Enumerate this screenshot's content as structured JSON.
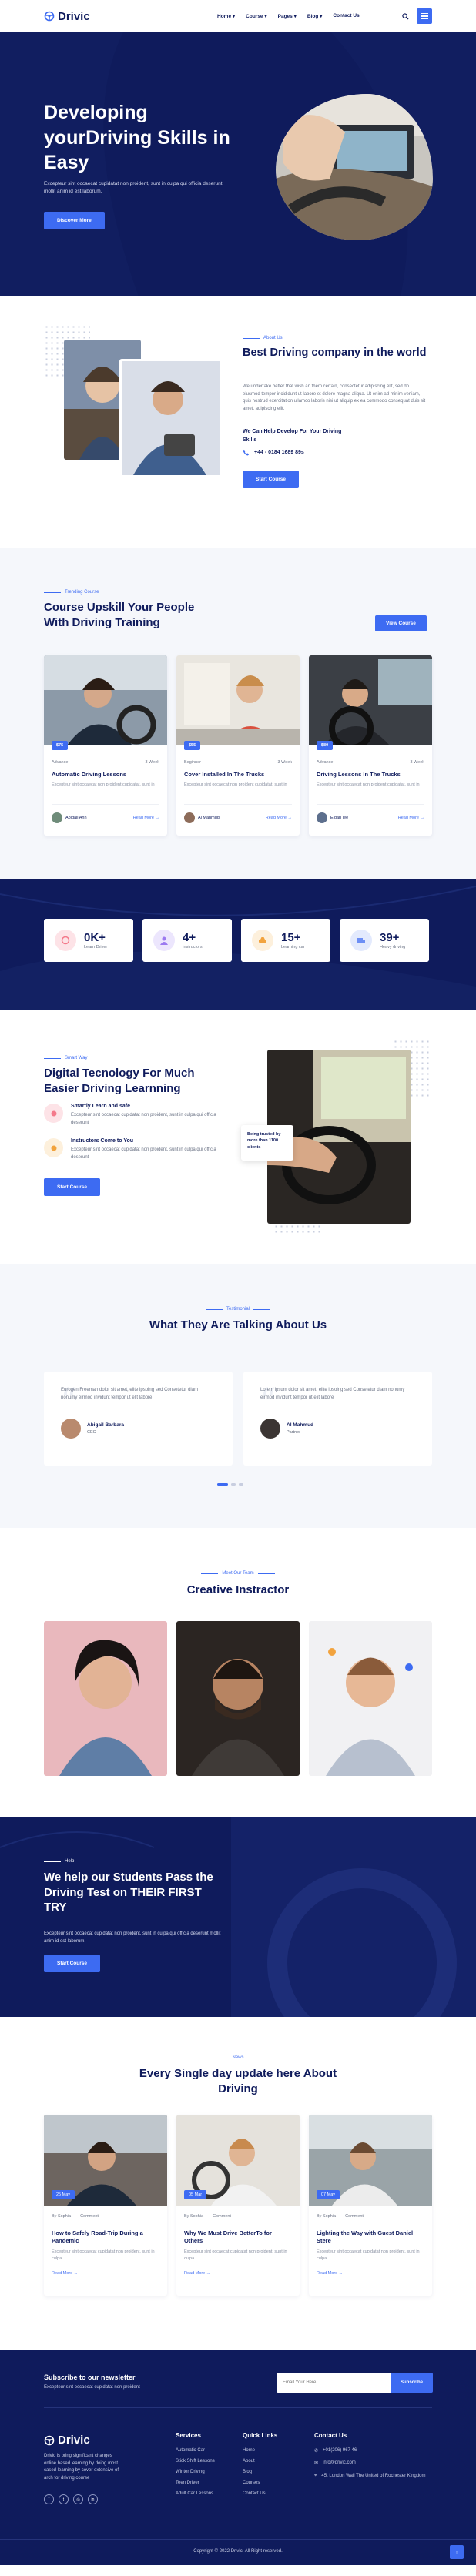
{
  "brand": {
    "name": "Drivic"
  },
  "nav": {
    "items": [
      "Home ▾",
      "Course ▾",
      "Pages ▾",
      "Blog ▾",
      "Contact Us"
    ]
  },
  "hero": {
    "title": "Developing yourDriving Skills in Easy",
    "subtitle": "Excepteur sint occaecat cupidatat non proident, sunt in culpa qui officia deserunt mollit anim id est laborum.",
    "button": "Discover More"
  },
  "about": {
    "kicker": "About Us",
    "title": "Best Driving company in the world",
    "text": "We undertake better that wish an them certain, consectetur adipiscing elit, sed do eiusmod tempor incididunt ut labore et dolore magna aliqua. Ut enim ad minim veniam, quis nostrud exercitation ullamco laboris nisi ut aliquip ex ea commodo consequat duis sit amet, adipiscing elit.",
    "help_title": "We Can Help Develop For Your Driving Skills",
    "phone": "+44 - 0184 1689 89s",
    "button": "Start Course"
  },
  "courses": {
    "kicker": "Trending Course",
    "title": "Course Upskill Your People With Driving Training",
    "button": "View Course",
    "items": [
      {
        "price": "$75",
        "level": "Advance",
        "duration": "3 Week",
        "title": "Automatic Driving Lessons",
        "desc": "Excepteur sint occaecat non proident cupidatat, sunt in",
        "author": "Abigail Ann",
        "more": "Read More →"
      },
      {
        "price": "$55",
        "level": "Beginner",
        "duration": "3 Week",
        "title": "Cover Installed In The Trucks",
        "desc": "Excepteur sint occaecat non proident cupidatat, sunt in",
        "author": "Al Mahmud",
        "more": "Read More →"
      },
      {
        "price": "$80",
        "level": "Advance",
        "duration": "3 Week",
        "title": "Driving Lessons In The Trucks",
        "desc": "Excepteur sint occaecat non proident cupidatat, sunt in",
        "author": "Elgari Iee",
        "more": "Read More →"
      }
    ]
  },
  "stats": {
    "items": [
      {
        "value": "0K+",
        "label": "Learn Driver",
        "color": "#f47a8b",
        "bg": "#fde3e7"
      },
      {
        "value": "4+",
        "label": "Instructors",
        "color": "#9b7af0",
        "bg": "#ece6fd"
      },
      {
        "value": "15+",
        "label": "Learning car",
        "color": "#f2a33d",
        "bg": "#fdf0dc"
      },
      {
        "value": "39+",
        "label": "Heavy driving",
        "color": "#6d8ff5",
        "bg": "#e3eafd"
      }
    ]
  },
  "digital": {
    "kicker": "Smart Way",
    "title": "Digital Tecnology For Much Easier Driving Learnning",
    "features": [
      {
        "title": "Smartly Learn and safe",
        "text": "Excepteur sint occaecat cupidatat non proident, sunt in culpa qui officia deserunt"
      },
      {
        "title": "Instructors Come to You",
        "text": "Excepteur sint occaecat cupidatat non proident, sunt in culpa qui officia deserunt"
      }
    ],
    "button": "Start Course",
    "badge": "Being trusted by more than 1100 clients"
  },
  "testimonials": {
    "kicker": "Testimonial",
    "title": "What They Are Talking About Us",
    "items": [
      {
        "quote": "Eurogen Freeman dolor sit amet, elite ipsoing sed Consetetur diam nonumy eirmod invidunt tempor ut elit labore",
        "name": "Abigail Barbara",
        "role": "CEO"
      },
      {
        "quote": "Lorem ipsum dolor sit amet, elite ipsoing sed Consetetur diam nonumy eirmod invidunt tempor ut elit labore",
        "name": "Al Mahmud",
        "role": "Partner"
      }
    ]
  },
  "team": {
    "kicker": "Meet Our Team",
    "title": "Creative Instractor"
  },
  "help": {
    "kicker": "Help",
    "title": "We help our Students Pass the Driving Test on THEIR FIRST TRY",
    "subtitle": "Excepteur sint occaecat cupidatat non proident, sunt in culpa qui officia deserunt mollit anim id est laborum.",
    "button": "Start Course"
  },
  "news": {
    "kicker": "News",
    "title": "Every Single day update here About Driving",
    "items": [
      {
        "date": "25 May",
        "author": "By Sophia",
        "comment": "Comment",
        "title": "How to Safely Road-Trip During a Pandemic",
        "desc": "Excepteur sint occaecat cupidatat non proident, sunt in culpa",
        "more": "Read More →"
      },
      {
        "date": "05 Mar",
        "author": "By Sophia",
        "comment": "Comment",
        "title": "Why We Must Drive BetterTo for Others",
        "desc": "Excepteur sint occaecat cupidatat non proident, sunt in culpa",
        "more": "Read More →"
      },
      {
        "date": "07 May",
        "author": "By Sophia",
        "comment": "Comment",
        "title": "Lighting the Way with Guest Daniel Stere",
        "desc": "Excepteur sint occaecat cupidatat non proident, sunt in culpa",
        "more": "Read More →"
      }
    ]
  },
  "newsletter": {
    "title": "Subscribe to our newsletter",
    "subtitle": "Excepteur sint occaecat cupidatat non proident",
    "placeholder": "Email Your Here",
    "button": "Subscribe"
  },
  "footer": {
    "about": "Drivic is bring significant changes online based learning by doing most cased learning by cover extensive of arch for driving course",
    "services_title": "Services",
    "services": [
      "Automatic Car",
      "Stick Shift Lessons",
      "Winter Driving",
      "Teen Driver",
      "Adult Car Lessons"
    ],
    "links_title": "Quick Links",
    "links": [
      "Home",
      "About",
      "Blog",
      "Courses",
      "Contact Us"
    ],
    "contact_title": "Contact Us",
    "phone": "+01(206) 967 46",
    "email": "info@drivic.com",
    "address": "45, London Wall The United of Rochester Kingdom",
    "copyright": "Copyright © 2022 Drivic. All Right reserved."
  },
  "colors": {
    "navy": "#0f1b5c",
    "accent": "#3d6bf2"
  }
}
